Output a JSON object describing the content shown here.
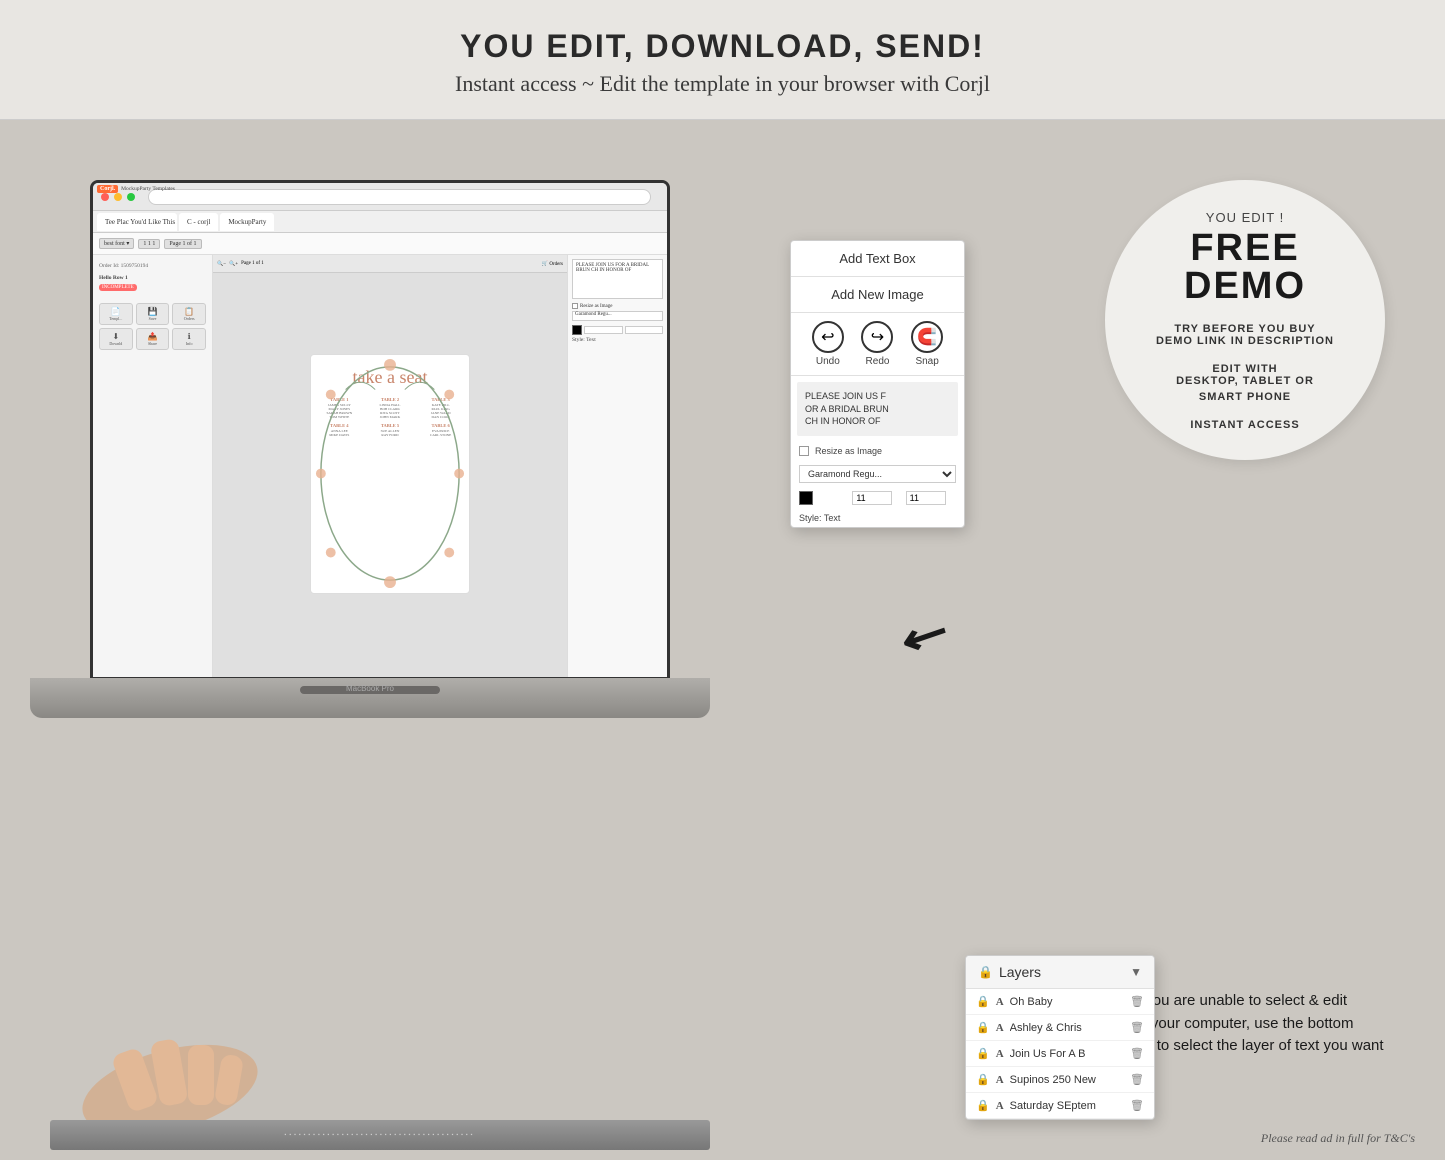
{
  "header": {
    "headline": "YOU EDIT, DOWNLOAD, SEND!",
    "subline": "Instant access ~ Edit the template in your browser with Corjl"
  },
  "free_demo_circle": {
    "you_edit": "YOU EDIT !",
    "free": "FREE",
    "demo": "DEMO",
    "try_before": "TRY BEFORE YOU BUY",
    "demo_link": "DEMO LINK IN DESCRIPTION",
    "edit_with": "EDIT WITH",
    "devices": "DESKTOP, TABLET OR",
    "smart_phone": "SMART PHONE",
    "instant": "INSTANT ACCESS"
  },
  "floating_panel": {
    "add_text_box": "Add Text Box",
    "add_new_image": "Add New Image",
    "undo_label": "Undo",
    "redo_label": "Redo",
    "snap_label": "Snap",
    "text_preview": "PLEASE JOIN US F\nOR A BRIDAL BRUN\nCH IN HONOR OF",
    "restore_image": "Resize as Image",
    "font_dropdown": "Garamond Regu...",
    "style_text": "Style: Text"
  },
  "layers_panel": {
    "title": "Layers",
    "items": [
      {
        "type": "A",
        "name": "Oh Baby",
        "locked": true,
        "selected": false
      },
      {
        "type": "A",
        "name": "Ashley & Chris",
        "locked": true,
        "selected": false
      },
      {
        "type": "A",
        "name": "Join Us For A B",
        "locked": true,
        "selected": false
      },
      {
        "type": "A",
        "name": "Supinos 250 New",
        "locked": true,
        "selected": false
      },
      {
        "type": "A",
        "name": "Saturday SEptem",
        "locked": true,
        "selected": false
      }
    ]
  },
  "handy_tip": {
    "text": "HANDY TIP: If you are unable to select & edit certain text. On your computer, use the bottom right hand panel to select the layer of text you want to edit"
  },
  "screen": {
    "order_id": "Order Id: 1509750194",
    "status": "INCOMPLETE",
    "canvas_title": "take a seat",
    "corjl_brand": "Corjl.",
    "corjl_subtitle": "MockupParty Templates"
  },
  "footer": {
    "please_read": "Please read ad in full for T&C's"
  },
  "arrows": {
    "down1": "↙",
    "down2": "↙"
  }
}
